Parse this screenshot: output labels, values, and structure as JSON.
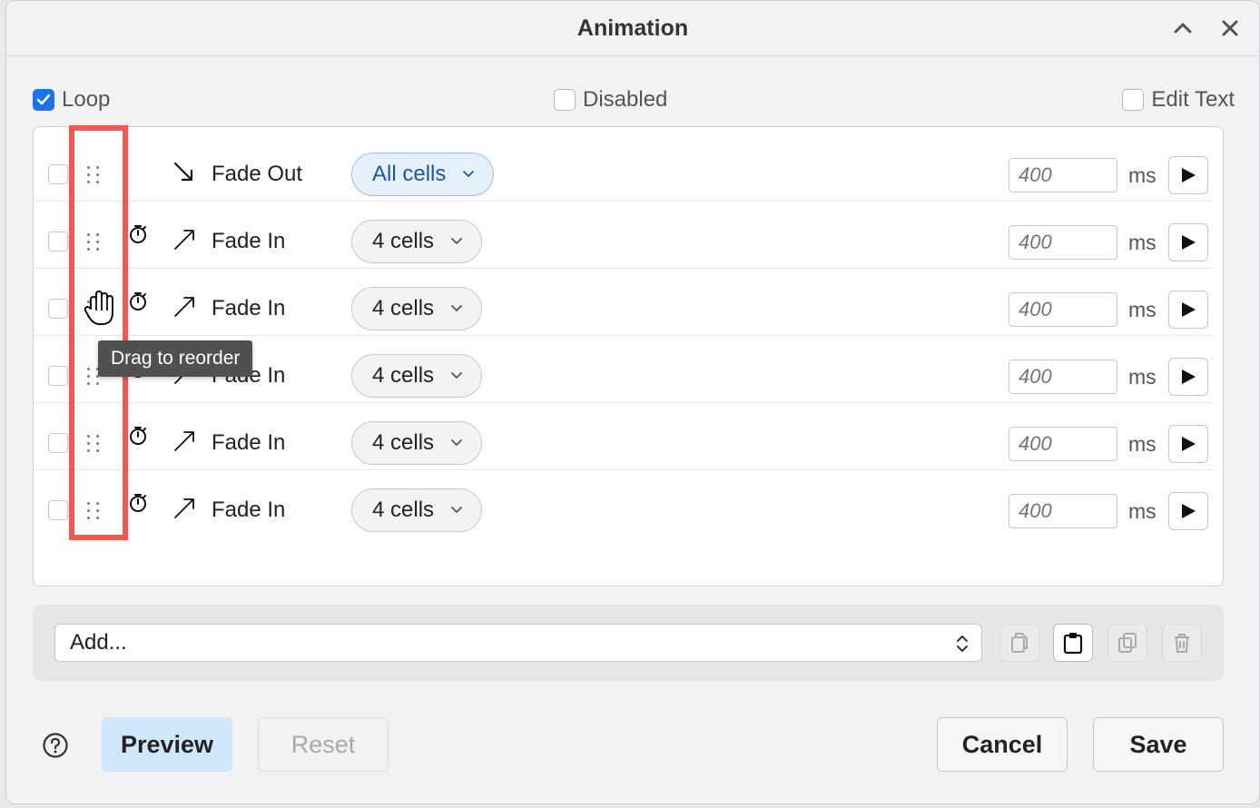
{
  "window": {
    "title": "Animation"
  },
  "options": {
    "loop": "Loop",
    "loop_checked": true,
    "disabled": "Disabled",
    "edit_text": "Edit Text"
  },
  "rows": [
    {
      "effect": "Fade Out",
      "direction": "out",
      "cells": "All cells",
      "duration_placeholder": "400",
      "unit": "ms",
      "timer": false
    },
    {
      "effect": "Fade In",
      "direction": "in",
      "cells": "4 cells",
      "duration_placeholder": "400",
      "unit": "ms",
      "timer": true
    },
    {
      "effect": "Fade In",
      "direction": "in",
      "cells": "4 cells",
      "duration_placeholder": "400",
      "unit": "ms",
      "timer": true
    },
    {
      "effect": "Fade In",
      "direction": "in",
      "cells": "4 cells",
      "duration_placeholder": "400",
      "unit": "ms",
      "timer": true
    },
    {
      "effect": "Fade In",
      "direction": "in",
      "cells": "4 cells",
      "duration_placeholder": "400",
      "unit": "ms",
      "timer": true
    },
    {
      "effect": "Fade In",
      "direction": "in",
      "cells": "4 cells",
      "duration_placeholder": "400",
      "unit": "ms",
      "timer": true
    }
  ],
  "tooltip": {
    "text": "Drag to reorder"
  },
  "add": {
    "label": "Add..."
  },
  "footer": {
    "preview": "Preview",
    "reset": "Reset",
    "cancel": "Cancel",
    "save": "Save"
  },
  "colors": {
    "accent": "#1b73e8",
    "highlight": "#f4574d",
    "preview_bg": "#cfe6fb"
  }
}
